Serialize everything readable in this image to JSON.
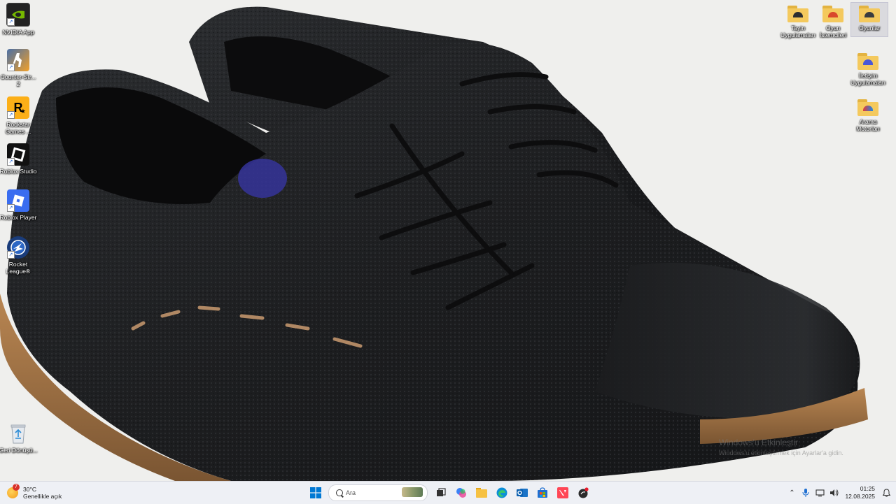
{
  "desktop": {
    "left_icons": [
      {
        "label": "NVIDIA App"
      },
      {
        "label": "Counter-Str... 2"
      },
      {
        "label": "Rockstar Games ..."
      },
      {
        "label": "Roblox Studio"
      },
      {
        "label": "Roblox Player"
      },
      {
        "label": "Rocket League®"
      },
      {
        "label": "Geri Dönüşü..."
      }
    ],
    "right_icons": [
      {
        "label": "Tayin Uygulamaları"
      },
      {
        "label": "Oyun İstemcileri"
      },
      {
        "label": "Oyunlar"
      },
      {
        "label": "İletişim Uygulamaları"
      },
      {
        "label": "Arama Motorları"
      }
    ]
  },
  "watermark": {
    "title": "Windows'u Etkinleştir",
    "subtitle": "Windows'u etkinleştirmek için Ayarlar'a gidin."
  },
  "taskbar": {
    "weather": {
      "badge": "7",
      "temp": "30°C",
      "desc": "Genellikle açık"
    },
    "search_placeholder": "Ara",
    "apps": [
      "start-icon",
      "task-view-icon",
      "copilot-icon",
      "file-explorer-icon",
      "edge-icon",
      "outlook-icon",
      "store-icon",
      "valorant-icon",
      "riot-client-icon"
    ],
    "clock": {
      "time": "01:25",
      "date": "12.08.2025"
    }
  },
  "colors": {
    "taskbar_bg": "#eef0f5",
    "folder": "#f4c95d",
    "accent": "#0078d4"
  }
}
